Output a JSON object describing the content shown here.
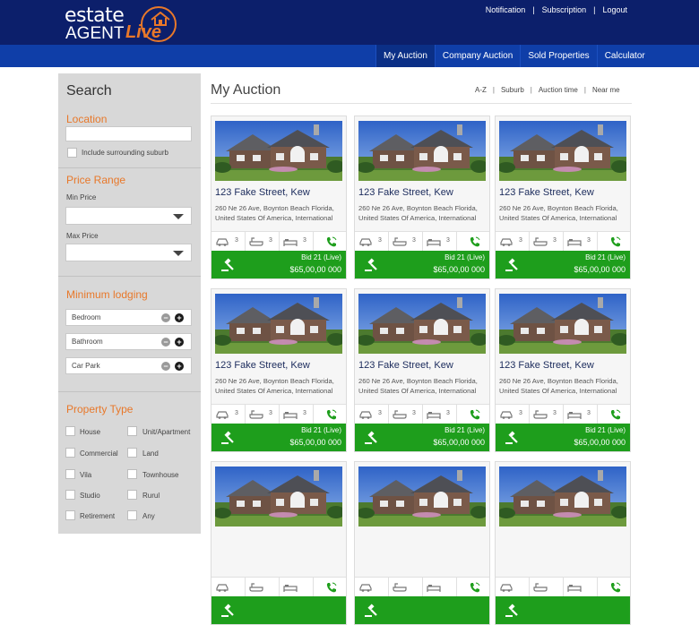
{
  "brand": {
    "line1": "estate",
    "line2": "AGENT",
    "line3": "Live",
    "accent_color": "#e8782a",
    "header_color": "#0c1f6b",
    "nav_color": "#0f3ea8",
    "bid_color": "#1e9e1c"
  },
  "top_links": [
    "Notification",
    "Subscription",
    "Logout"
  ],
  "nav": [
    "My Auction",
    "Company Auction",
    "Sold Properties",
    "Calculator"
  ],
  "sidebar": {
    "title": "Search",
    "location": {
      "heading": "Location",
      "search_value": "",
      "include_label": "Include surrounding suburb"
    },
    "price": {
      "heading": "Price Range",
      "min_label": "Min Price",
      "max_label": "Max Price"
    },
    "lodging": {
      "heading": "Minimum lodging",
      "items": [
        "Bedroom",
        "Bathroom",
        "Car Park"
      ]
    },
    "property_type": {
      "heading": "Property Type",
      "options": [
        "House",
        "Unit/Apartment",
        "Commercial",
        "Land",
        "Vila",
        "Townhouse",
        "Studio",
        "Rurul",
        "Retirement",
        "Any"
      ]
    }
  },
  "main": {
    "title": "My Auction",
    "sort_options": [
      "A-Z",
      "Suburb",
      "Auction time",
      "Near me"
    ]
  },
  "listings": [
    {
      "title": "123 Fake Street, Kew",
      "address_line1": "260 Ne 26 Ave, Boynton Beach Florida,",
      "address_line2": "United States Of America, International",
      "cars": "3",
      "baths": "3",
      "beds": "3",
      "bid_label": "Bid 21 (Live)",
      "price": "$65,00,00 000"
    },
    {
      "title": "123 Fake Street, Kew",
      "address_line1": "260 Ne 26 Ave, Boynton Beach Florida,",
      "address_line2": "United States Of America, International",
      "cars": "3",
      "baths": "3",
      "beds": "3",
      "bid_label": "Bid 21 (Live)",
      "price": "$65,00,00 000"
    },
    {
      "title": "123 Fake Street, Kew",
      "address_line1": "260 Ne 26 Ave, Boynton Beach Florida,",
      "address_line2": "United States Of America, International",
      "cars": "3",
      "baths": "3",
      "beds": "3",
      "bid_label": "Bid 21 (Live)",
      "price": "$65,00,00 000"
    },
    {
      "title": "123 Fake Street, Kew",
      "address_line1": "260 Ne 26 Ave, Boynton Beach Florida,",
      "address_line2": "United States Of America, International",
      "cars": "3",
      "baths": "3",
      "beds": "3",
      "bid_label": "Bid 21 (Live)",
      "price": "$65,00,00 000"
    },
    {
      "title": "123 Fake Street, Kew",
      "address_line1": "260 Ne 26 Ave, Boynton Beach Florida,",
      "address_line2": "United States Of America, International",
      "cars": "3",
      "baths": "3",
      "beds": "3",
      "bid_label": "Bid 21 (Live)",
      "price": "$65,00,00 000"
    },
    {
      "title": "123 Fake Street, Kew",
      "address_line1": "260 Ne 26 Ave, Boynton Beach Florida,",
      "address_line2": "United States Of America, International",
      "cars": "3",
      "baths": "3",
      "beds": "3",
      "bid_label": "Bid 21 (Live)",
      "price": "$65,00,00 000"
    },
    {
      "title": "",
      "address_line1": "",
      "address_line2": "",
      "cars": "",
      "baths": "",
      "beds": "",
      "bid_label": "",
      "price": ""
    },
    {
      "title": "",
      "address_line1": "",
      "address_line2": "",
      "cars": "",
      "baths": "",
      "beds": "",
      "bid_label": "",
      "price": ""
    },
    {
      "title": "",
      "address_line1": "",
      "address_line2": "",
      "cars": "",
      "baths": "",
      "beds": "",
      "bid_label": "",
      "price": ""
    }
  ]
}
